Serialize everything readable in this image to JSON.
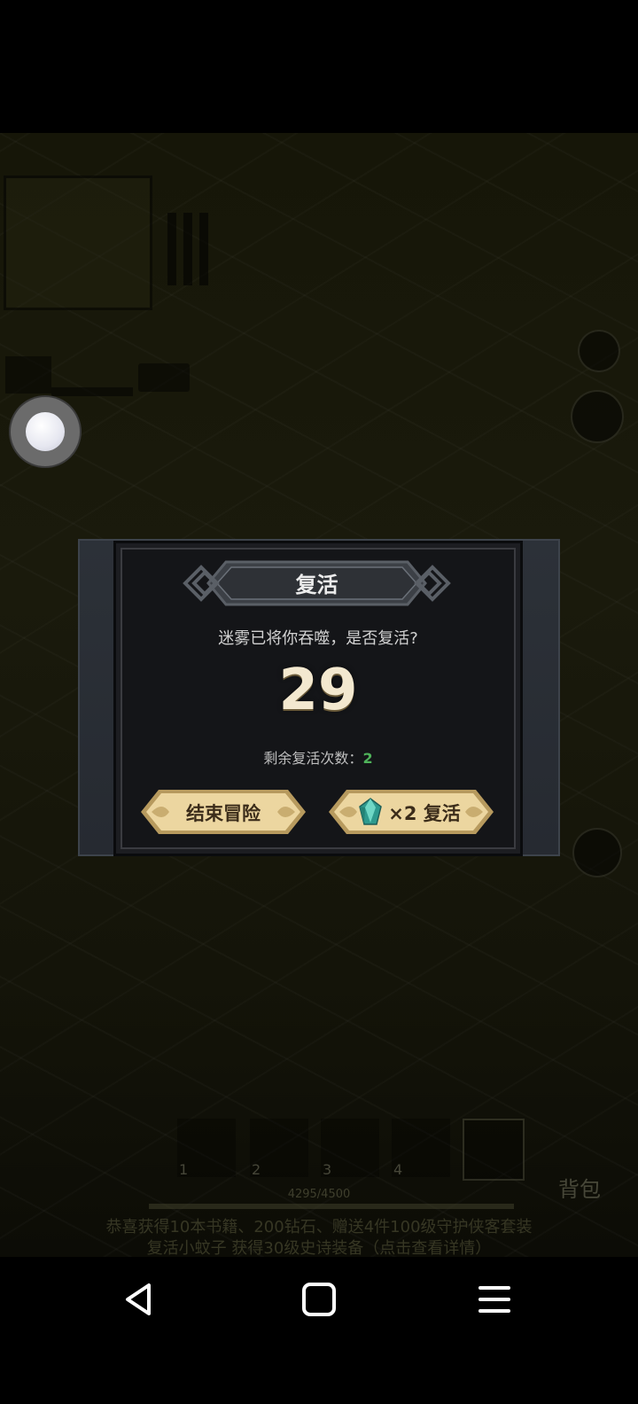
{
  "dialog": {
    "title": "复活",
    "question": "迷雾已将你吞噬，是否复活?",
    "countdown": "29",
    "remaining_label": "剩余复活次数：",
    "remaining_count": "2",
    "end_button_label": "结束冒险",
    "revive_button_label": "×2 复活",
    "revive_cost_icon": "gem-icon"
  },
  "game": {
    "bag_label": "背包",
    "skill_slots": [
      "1",
      "2",
      "3",
      "4"
    ],
    "xp_text": "4295/4500",
    "news_line_1": "恭喜获得10本书籍、200钻石、赠送4件100级守护侠客套装",
    "news_line_2": "复活小蚊子 获得30级史诗装备（点击查看详情）"
  },
  "nav": {
    "back_icon": "back-triangle-icon",
    "home_icon": "home-square-icon",
    "menu_icon": "menu-lines-icon"
  },
  "colors": {
    "remaining_count": "#4fb35a",
    "button_gold": "#e8cf95",
    "button_text": "#3b2c1a",
    "countdown": "#f3e8cf"
  }
}
